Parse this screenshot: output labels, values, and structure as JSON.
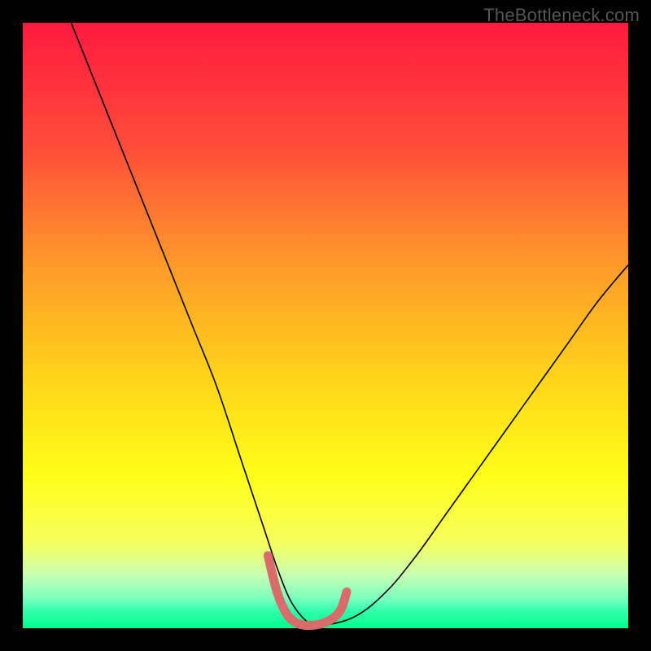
{
  "watermark": "TheBottleneck.com",
  "chart_data": {
    "type": "line",
    "title": "",
    "xlabel": "",
    "ylabel": "",
    "xlim": [
      0,
      100
    ],
    "ylim": [
      0,
      100
    ],
    "grid": false,
    "legend": false,
    "background_gradient": {
      "stops": [
        {
          "offset": 0.0,
          "color": "#ff1a3e"
        },
        {
          "offset": 0.2,
          "color": "#ff4b3a"
        },
        {
          "offset": 0.4,
          "color": "#ff9a2a"
        },
        {
          "offset": 0.58,
          "color": "#ffd21a"
        },
        {
          "offset": 0.75,
          "color": "#ffff1a"
        },
        {
          "offset": 0.86,
          "color": "#f6ff60"
        },
        {
          "offset": 0.91,
          "color": "#caffb0"
        },
        {
          "offset": 0.95,
          "color": "#7dffc0"
        },
        {
          "offset": 0.97,
          "color": "#36ffae"
        },
        {
          "offset": 1.0,
          "color": "#00ff8a"
        }
      ]
    },
    "series": [
      {
        "name": "bottleneck-curve",
        "stroke": "#000000",
        "stroke_width": 1.6,
        "x": [
          8,
          12,
          16,
          20,
          24,
          28,
          32,
          36,
          38,
          40,
          42,
          44,
          46,
          48,
          50,
          55,
          60,
          65,
          70,
          75,
          80,
          85,
          90,
          95,
          100
        ],
        "y": [
          100,
          90,
          80,
          70,
          60,
          50,
          40,
          28,
          22,
          16,
          10,
          5,
          2,
          0.5,
          0.5,
          2,
          6,
          12,
          19,
          26,
          33,
          40,
          47,
          54,
          60
        ]
      }
    ],
    "highlight": {
      "name": "optimal-range",
      "stroke": "#d96b6b",
      "stroke_width": 11,
      "x": [
        40.5,
        42,
        43.5,
        45,
        46.5,
        48,
        49.5,
        51,
        52.5,
        53.5
      ],
      "y": [
        12,
        6,
        2.5,
        1,
        0.5,
        0.5,
        0.8,
        1.5,
        3,
        6
      ]
    }
  }
}
